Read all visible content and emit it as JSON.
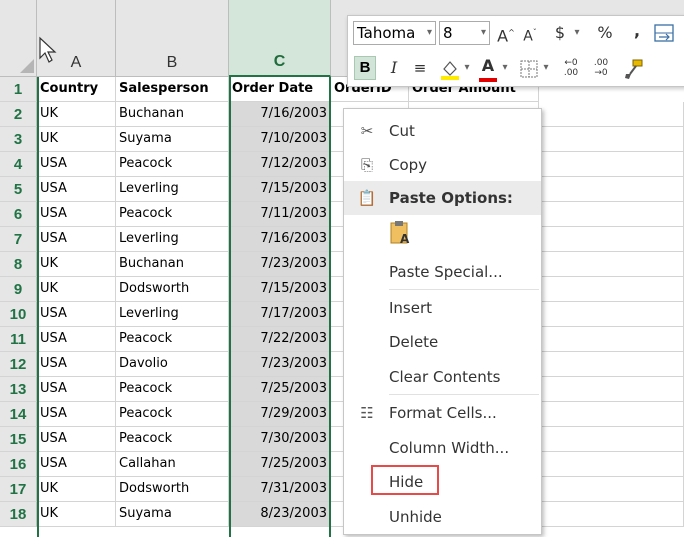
{
  "columns": [
    "A",
    "B",
    "C"
  ],
  "header_row": {
    "country": "Country",
    "salesperson": "Salesperson",
    "order_date": "Order Date",
    "order_id": "OrderID",
    "order_amount": "Order Amount"
  },
  "rows": [
    {
      "n": "2",
      "country": "UK",
      "salesperson": "Buchanan",
      "date": "7/16/2003"
    },
    {
      "n": "3",
      "country": "UK",
      "salesperson": "Suyama",
      "date": "7/10/2003"
    },
    {
      "n": "4",
      "country": "USA",
      "salesperson": "Peacock",
      "date": "7/12/2003"
    },
    {
      "n": "5",
      "country": "USA",
      "salesperson": "Leverling",
      "date": "7/15/2003"
    },
    {
      "n": "6",
      "country": "USA",
      "salesperson": "Peacock",
      "date": "7/11/2003"
    },
    {
      "n": "7",
      "country": "USA",
      "salesperson": "Leverling",
      "date": "7/16/2003"
    },
    {
      "n": "8",
      "country": "UK",
      "salesperson": "Buchanan",
      "date": "7/23/2003"
    },
    {
      "n": "9",
      "country": "UK",
      "salesperson": "Dodsworth",
      "date": "7/15/2003"
    },
    {
      "n": "10",
      "country": "USA",
      "salesperson": "Leverling",
      "date": "7/17/2003"
    },
    {
      "n": "11",
      "country": "USA",
      "salesperson": "Peacock",
      "date": "7/22/2003"
    },
    {
      "n": "12",
      "country": "USA",
      "salesperson": "Davolio",
      "date": "7/23/2003"
    },
    {
      "n": "13",
      "country": "USA",
      "salesperson": "Peacock",
      "date": "7/25/2003"
    },
    {
      "n": "14",
      "country": "USA",
      "salesperson": "Peacock",
      "date": "7/29/2003"
    },
    {
      "n": "15",
      "country": "USA",
      "salesperson": "Peacock",
      "date": "7/30/2003"
    },
    {
      "n": "16",
      "country": "USA",
      "salesperson": "Callahan",
      "date": "7/25/2003"
    },
    {
      "n": "17",
      "country": "UK",
      "salesperson": "Dodsworth",
      "date": "7/31/2003"
    },
    {
      "n": "18",
      "country": "UK",
      "salesperson": "Suyama",
      "date": "8/23/2003"
    }
  ],
  "row1_label": "1",
  "mini_toolbar": {
    "font_name": "Tahoma",
    "font_size": "8",
    "bold": "B",
    "italic": "I",
    "currency": "$",
    "percent": "%",
    "comma": ","
  },
  "context_menu": {
    "cut": "Cut",
    "copy": "Copy",
    "paste_options": "Paste Options:",
    "paste_special": "Paste Special...",
    "insert": "Insert",
    "delete": "Delete",
    "clear_contents": "Clear Contents",
    "format_cells": "Format Cells...",
    "column_width": "Column Width...",
    "hide": "Hide",
    "unhide": "Unhide"
  },
  "colors": {
    "accent": "#217346",
    "highlight": "#e84a4a"
  }
}
